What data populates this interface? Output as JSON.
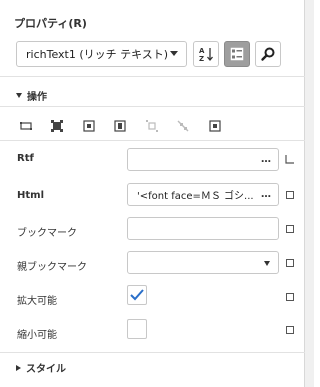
{
  "panel": {
    "title": "プロパティ(R)"
  },
  "selector": {
    "value": "richText1 (リッチ テキスト)"
  },
  "toolbar": {
    "buttons": [
      "sort-az",
      "categorized",
      "search"
    ]
  },
  "sections": {
    "operation": "操作",
    "style": "スタイル"
  },
  "properties": {
    "rtf": {
      "label": "Rtf",
      "value": ""
    },
    "html": {
      "label": "Html",
      "value": "'<font face=ＭＳ ゴシ..."
    },
    "bookmark": {
      "label": "ブックマーク",
      "value": ""
    },
    "parent_bookmark": {
      "label": "親ブックマーク",
      "value": ""
    },
    "can_grow": {
      "label": "拡大可能",
      "checked": true
    },
    "can_shrink": {
      "label": "縮小可能",
      "checked": false
    }
  },
  "ellipsis": "…"
}
